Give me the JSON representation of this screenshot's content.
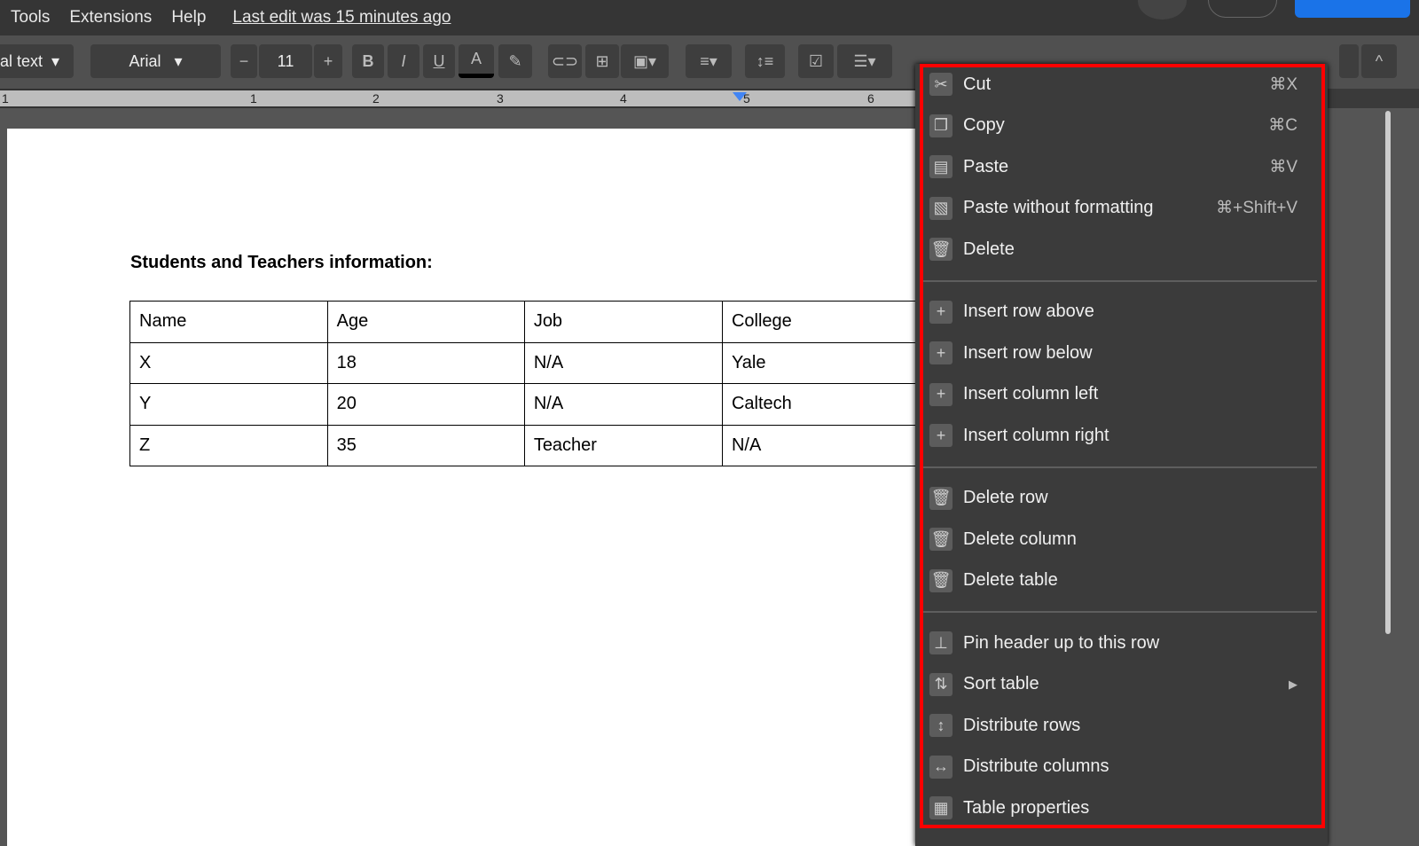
{
  "menubar": {
    "items": [
      "Tools",
      "Extensions",
      "Help"
    ],
    "last_edit": "Last edit was 15 minutes ago"
  },
  "toolbar": {
    "style": "al text",
    "font": "Arial",
    "font_size": "11",
    "minus": "−",
    "plus": "+",
    "bold": "B",
    "italic": "I",
    "underline": "U",
    "text_color": "A"
  },
  "ruler": {
    "labels": [
      "1",
      "1",
      "2",
      "3",
      "4",
      "5",
      "6"
    ]
  },
  "document": {
    "heading": "Students and Teachers information:",
    "table": [
      [
        "Name",
        "Age",
        "Job",
        "College"
      ],
      [
        "X",
        "18",
        "N/A",
        "Yale"
      ],
      [
        "Y",
        "20",
        "N/A",
        "Caltech"
      ],
      [
        "Z",
        "35",
        "Teacher",
        "N/A"
      ]
    ]
  },
  "context_menu": {
    "groups": [
      [
        {
          "label": "Cut",
          "shortcut": "⌘X",
          "icon": "scissors-icon"
        },
        {
          "label": "Copy",
          "shortcut": "⌘C",
          "icon": "copy-icon"
        },
        {
          "label": "Paste",
          "shortcut": "⌘V",
          "icon": "clipboard-icon"
        },
        {
          "label": "Paste without formatting",
          "shortcut": "⌘+Shift+V",
          "icon": "paste-plain-icon"
        },
        {
          "label": "Delete",
          "shortcut": "",
          "icon": "trash-icon"
        }
      ],
      [
        {
          "label": "Insert row above",
          "icon": "plus-icon"
        },
        {
          "label": "Insert row below",
          "icon": "plus-icon"
        },
        {
          "label": "Insert column left",
          "icon": "plus-icon"
        },
        {
          "label": "Insert column right",
          "icon": "plus-icon"
        }
      ],
      [
        {
          "label": "Delete row",
          "icon": "trash-icon"
        },
        {
          "label": "Delete column",
          "icon": "trash-icon"
        },
        {
          "label": "Delete table",
          "icon": "trash-icon"
        }
      ],
      [
        {
          "label": "Pin header up to this row",
          "icon": "pin-icon"
        },
        {
          "label": "Sort table",
          "icon": "sort-icon",
          "submenu": true
        },
        {
          "label": "Distribute rows",
          "icon": "distribute-rows-icon"
        },
        {
          "label": "Distribute columns",
          "icon": "distribute-columns-icon"
        },
        {
          "label": "Table properties",
          "icon": "table-icon"
        }
      ]
    ]
  },
  "colors": {
    "highlight_border": "#ff0000",
    "share_button": "#1a73e8"
  }
}
